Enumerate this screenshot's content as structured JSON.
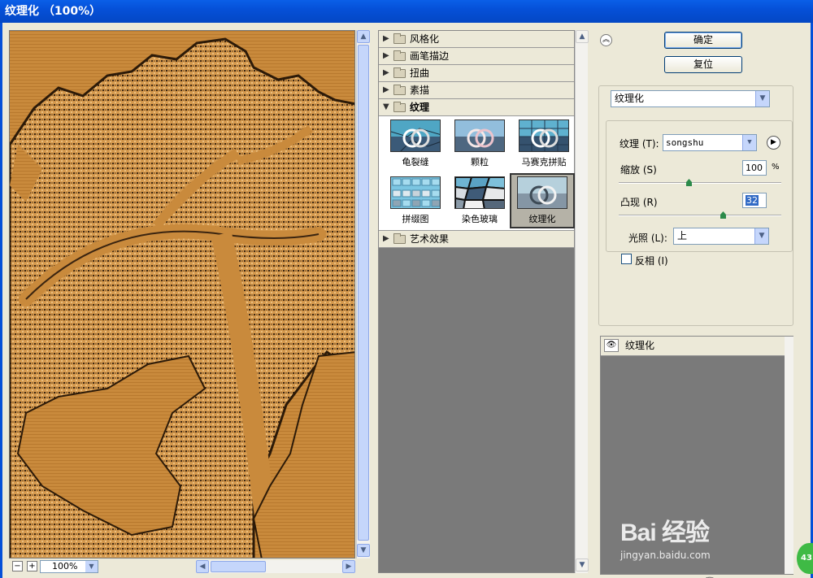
{
  "window": {
    "title": "纹理化 （100%）"
  },
  "preview": {
    "zoom": "100%",
    "zoom_out": "−",
    "zoom_in": "+"
  },
  "gallery": {
    "categories": [
      {
        "label": "风格化",
        "open": false
      },
      {
        "label": "画笔描边",
        "open": false
      },
      {
        "label": "扭曲",
        "open": false
      },
      {
        "label": "素描",
        "open": false
      },
      {
        "label": "纹理",
        "open": true
      },
      {
        "label": "艺术效果",
        "open": false
      }
    ],
    "texture_filters": [
      "龟裂缝",
      "颗粒",
      "马赛克拼贴",
      "拼缀图",
      "染色玻璃",
      "纹理化"
    ],
    "selected_filter": "纹理化"
  },
  "settings": {
    "ok_label": "确定",
    "reset_label": "复位",
    "filter_select": "纹理化",
    "texture_label": "纹理 (T):",
    "texture_value": "songshu",
    "scaling_label": "缩放 (S)",
    "scaling_value": "100",
    "scaling_unit": "%",
    "scaling_level": 0.43,
    "relief_label": "凸现 (R)",
    "relief_value": "32",
    "relief_level": 0.64,
    "light_label": "光照 (L):",
    "light_value": "上",
    "invert_label": "反相 (I)",
    "invert_checked": false
  },
  "layers": {
    "items": [
      "纹理化"
    ]
  },
  "watermark": {
    "logo": "Bai 经验",
    "url": "jingyan.baidu.com",
    "badge": "43"
  }
}
